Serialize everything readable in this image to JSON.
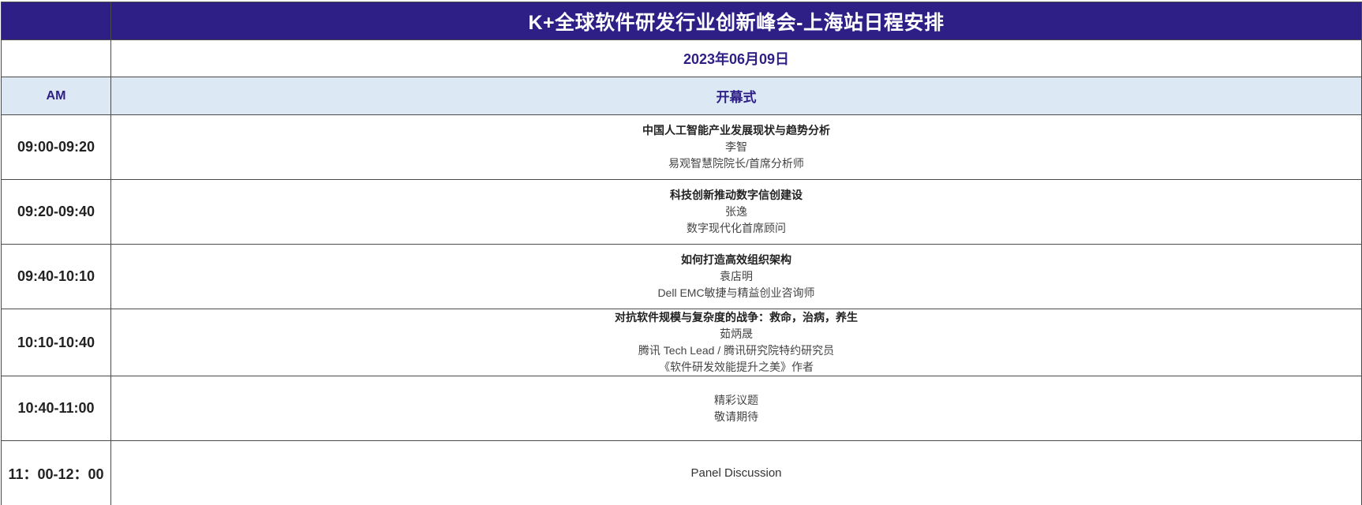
{
  "header": {
    "title": "K+全球软件研发行业创新峰会-上海站日程安排",
    "date": "2023年06月09日"
  },
  "session": {
    "period": "AM",
    "name": "开幕式"
  },
  "talks": [
    {
      "time": "09:00-09:20",
      "title": "中国人工智能产业发展现状与趋势分析",
      "speaker": "李智",
      "role": "易观智慧院院长/首席分析师"
    },
    {
      "time": "09:20-09:40",
      "title": "科技创新推动数字信创建设",
      "speaker": "张逸",
      "role": "数字现代化首席顾问"
    },
    {
      "time": "09:40-10:10",
      "title": "如何打造高效组织架构",
      "speaker": "袁店明",
      "role": "Dell EMC敏捷与精益创业咨询师"
    },
    {
      "time": "10:10-10:40",
      "title": "对抗软件规模与复杂度的战争：救命，治病，养生",
      "speaker": "茹炳晟",
      "role": "腾讯 Tech Lead / 腾讯研究院特约研究员",
      "extra": "《软件研发效能提升之美》作者"
    },
    {
      "time": "10:40-11:00",
      "line1": "精彩议题",
      "line2": "敬请期待"
    },
    {
      "time": "11：00-12：00",
      "panel": "Panel Discussion"
    }
  ]
}
